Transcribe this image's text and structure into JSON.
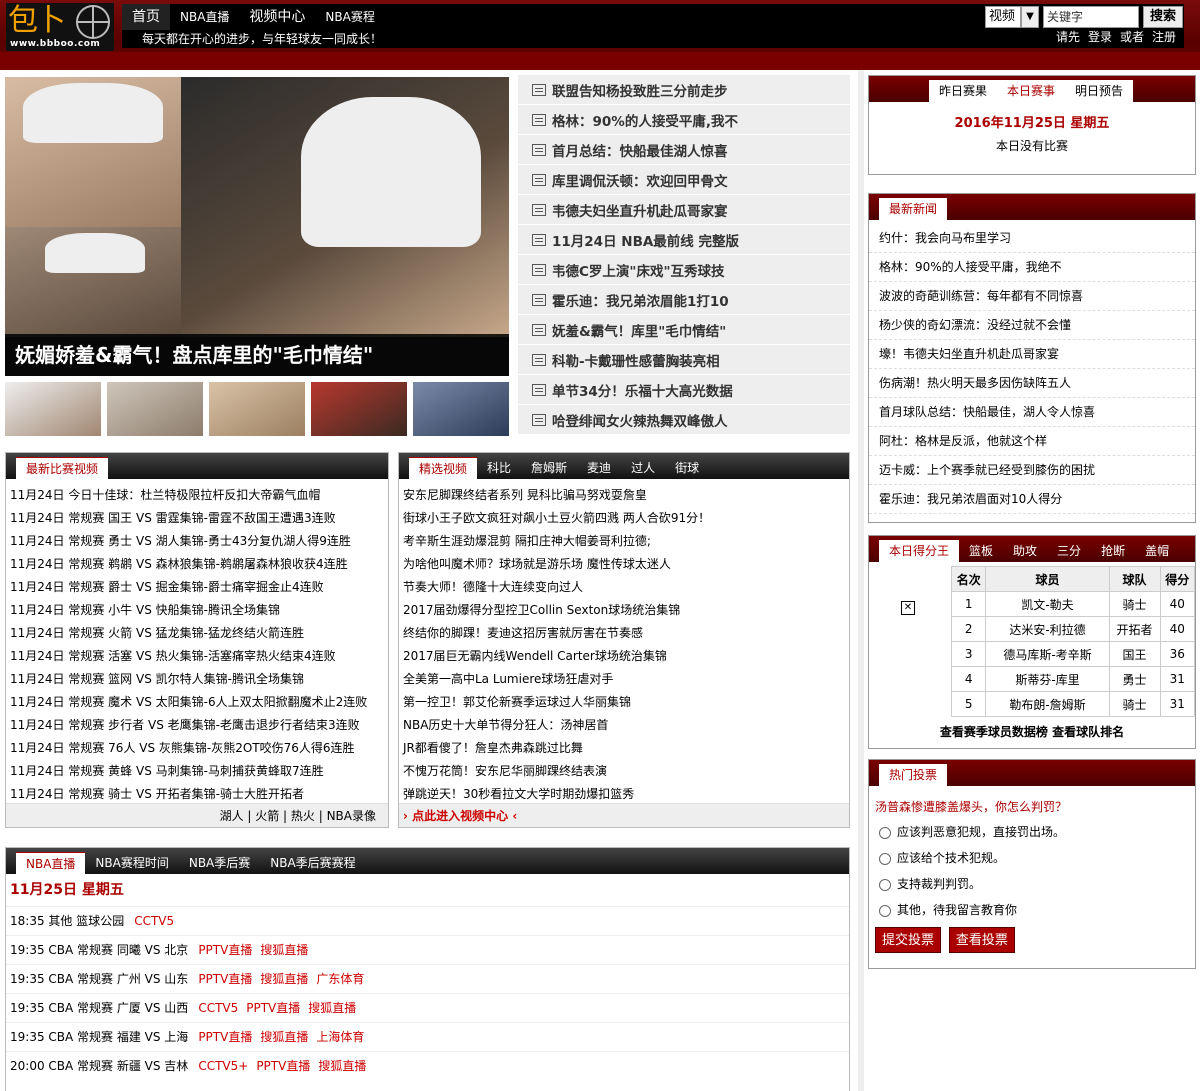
{
  "site": {
    "logo_text": "包卜",
    "logo_url": "www.bbboo.com",
    "slogan": "每天都在开心的进步，与年轻球友一同成长！"
  },
  "nav": {
    "items": [
      "首页",
      "NBA直播",
      "视频中心",
      "NBA赛程"
    ]
  },
  "search": {
    "select_value": "视频",
    "placeholder": "关键字",
    "button": "搜索"
  },
  "login": {
    "prefix": "请先",
    "login": "登录",
    "or": "或者",
    "register": "注册"
  },
  "hero": {
    "caption": "妩媚娇羞&霸气！盘点库里的\"毛巾情结\""
  },
  "headlines": [
    "联盟告知杨投致胜三分前走步",
    "格林：90%的人接受平庸,我不",
    "首月总结：快船最佳湖人惊喜",
    "库里调侃沃顿：欢迎回甲骨文",
    "韦德夫妇坐直升机赴瓜哥家宴",
    "11月24日 NBA最前线 完整版",
    "韦德C罗上演\"床戏\"互秀球技",
    "霍乐迪：我兄弟浓眉能1打10",
    "妩羞&霸气！库里\"毛巾情结\"",
    "科勒-卡戴珊性感蕾胸装亮相",
    "单节34分！乐福十大高光数据",
    "哈登绯闻女火辣热舞双峰傲人"
  ],
  "latest_video": {
    "tab": "最新比赛视频",
    "rows": [
      "11月24日  今日十佳球：杜兰特极限拉杆反扣大帝霸气血帽",
      "11月24日  常规赛 国王 VS 雷霆集锦-雷霆不敌国王遭遇3连败",
      "11月24日  常规赛 勇士 VS 湖人集锦-勇士43分复仇湖人得9连胜",
      "11月24日  常规赛 鹈鹕 VS 森林狼集锦-鹈鹕屠森林狼收获4连胜",
      "11月24日  常规赛 爵士 VS 掘金集锦-爵士痛宰掘金止4连败",
      "11月24日  常规赛 小牛 VS 快船集锦-腾讯全场集锦",
      "11月24日  常规赛 火箭 VS 猛龙集锦-猛龙终结火箭连胜",
      "11月24日  常规赛 活塞 VS 热火集锦-活塞痛宰热火结束4连败",
      "11月24日  常规赛 篮网 VS 凯尔特人集锦-腾讯全场集锦",
      "11月24日  常规赛 魔术 VS 太阳集锦-6人上双太阳掀翻魔术止2连败",
      "11月24日  常规赛 步行者 VS 老鹰集锦-老鹰击退步行者结束3连败",
      "11月24日  常规赛 76人 VS 灰熊集锦-灰熊2OT咬伤76人得6连胜",
      "11月24日  常规赛 黄蜂 VS 马刺集锦-马刺捕获黄蜂取7连胜",
      "11月24日  常规赛 骑士 VS 开拓者集锦-骑士大胜开拓者"
    ],
    "footer": "湖人 | 火箭 | 热火 | NBA录像"
  },
  "featured_video": {
    "tabs": [
      "精选视频",
      "科比",
      "詹姆斯",
      "麦迪",
      "过人",
      "街球"
    ],
    "rows": [
      "安东尼脚踝终结者系列 晃科比骗马努戏耍詹皇",
      "街球小王子欧文疯狂对飙小土豆火箭四溅 两人合砍91分！",
      "考辛斯生涯劲爆混剪 隔扣庄神大帽姜哥利拉德;",
      "为啥他叫魔术师？球场就是游乐场 魔性传球太迷人",
      "节奏大师！德隆十大连续变向过人",
      "2017届劲爆得分型控卫Collin Sexton球场统治集锦",
      "终结你的脚踝！麦迪这招厉害就厉害在节奏感",
      "2017届巨无霸内线Wendell Carter球场统治集锦",
      "全美第一高中La Lumiere球场狂虐对手",
      "第一控卫！郭艾伦新赛季运球过人华丽集锦",
      "NBA历史十大单节得分狂人：汤神居首",
      "JR都看傻了！詹皇杰弗森跳过比舞",
      "不愧万花筒！安东尼华丽脚踝终结表演",
      "弹跳逆天！30秒看拉文大学时期劲爆扣篮秀"
    ],
    "footer": "点此进入视频中心"
  },
  "live": {
    "tabs": [
      "NBA直播",
      "NBA赛程时间",
      "NBA季后赛",
      "NBA季后赛赛程"
    ],
    "date": "11月25日 星期五",
    "rows": [
      {
        "text": "18:35 其他 篮球公园",
        "links": [
          "CCTV5"
        ]
      },
      {
        "text": "19:35 CBA 常规赛 同曦 VS 北京",
        "links": [
          "PPTV直播",
          "搜狐直播"
        ]
      },
      {
        "text": "19:35 CBA 常规赛 广州 VS 山东",
        "links": [
          "PPTV直播",
          "搜狐直播",
          "广东体育"
        ]
      },
      {
        "text": "19:35 CBA 常规赛 广厦 VS 山西",
        "links": [
          "CCTV5",
          "PPTV直播",
          "搜狐直播"
        ]
      },
      {
        "text": "19:35 CBA 常规赛 福建 VS 上海",
        "links": [
          "PPTV直播",
          "搜狐直播",
          "上海体育"
        ]
      },
      {
        "text": "20:00 CBA 常规赛 新疆 VS 吉林",
        "links": [
          "CCTV5+",
          "PPTV直播",
          "搜狐直播"
        ]
      }
    ]
  },
  "games": {
    "tabs": [
      "昨日赛果",
      "本日赛事",
      "明日预告"
    ],
    "date": "2016年11月25日 星期五",
    "note": "本日没有比赛"
  },
  "news": {
    "tab": "最新新闻",
    "rows": [
      "约什：我会向马布里学习",
      "格林：90%的人接受平庸，我绝不",
      "波波的奇葩训练营：每年都有不同惊喜",
      "杨少侠的奇幻漂流：没经过就不会懂",
      "壕！韦德夫妇坐直升机赴瓜哥家宴",
      "伤病潮！热火明天最多因伤缺阵五人",
      "首月球队总结：快船最佳，湖人令人惊喜",
      "阿杜：格林是反派，他就这个样",
      "迈卡威：上个赛季就已经受到膝伤的困扰",
      "霍乐迪：我兄弟浓眉面对10人得分"
    ]
  },
  "scorers": {
    "tabs": [
      "本日得分王",
      "篮板",
      "助攻",
      "三分",
      "抢断",
      "盖帽"
    ],
    "headers": [
      "名次",
      "球员",
      "球队",
      "得分"
    ],
    "rows": [
      [
        "1",
        "凯文-勒夫",
        "骑士",
        "40"
      ],
      [
        "2",
        "达米安-利拉德",
        "开拓者",
        "40"
      ],
      [
        "3",
        "德马库斯-考辛斯",
        "国王",
        "36"
      ],
      [
        "4",
        "斯蒂芬-库里",
        "勇士",
        "31"
      ],
      [
        "5",
        "勒布朗-詹姆斯",
        "骑士",
        "31"
      ]
    ],
    "links": [
      "查看赛季球员数据榜",
      "查看球队排名"
    ]
  },
  "poll": {
    "tab": "热门投票",
    "question": "汤普森惨遭膝盖爆头，你怎么判罚？",
    "options": [
      "应该判恶意犯规，直接罚出场。",
      "应该给个技术犯规。",
      "支持裁判判罚。",
      "其他，待我留言教育你"
    ],
    "submit": "提交投票",
    "view": "查看投票"
  }
}
